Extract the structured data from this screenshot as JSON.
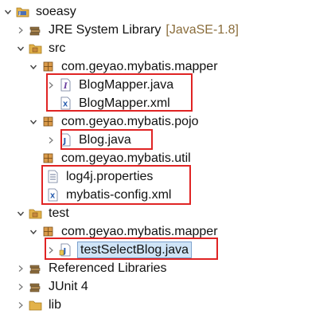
{
  "tree": {
    "project": "soeasy",
    "jre": {
      "label": "JRE System Library",
      "decoration": "[JavaSE-1.8]"
    },
    "src": "src",
    "pkg_mapper": "com.geyao.mybatis.mapper",
    "blog_mapper_java": "BlogMapper.java",
    "blog_mapper_xml": "BlogMapper.xml",
    "pkg_pojo": "com.geyao.mybatis.pojo",
    "blog_java": "Blog.java",
    "pkg_util": "com.geyao.mybatis.util",
    "log4j": "log4j.properties",
    "mybatis_config": "mybatis-config.xml",
    "test": "test",
    "test_pkg_mapper": "com.geyao.mybatis.mapper",
    "test_select_blog": "testSelectBlog.java",
    "referenced_libraries": "Referenced Libraries",
    "junit": "JUnit 4",
    "lib": "lib"
  },
  "colors": {
    "highlight_border": "#e02424",
    "selection_bg": "#cfe4f7",
    "decoration": "#8a6d3b",
    "package_icon": "#c98a3c",
    "folder_icon": "#e3b24a"
  },
  "icons": [
    "chevron-down-icon",
    "chevron-right-icon",
    "project-icon",
    "library-icon",
    "source-folder-icon",
    "package-icon",
    "java-interface-icon",
    "xml-file-icon",
    "java-class-icon",
    "properties-file-icon",
    "junit-test-icon",
    "folder-icon"
  ]
}
